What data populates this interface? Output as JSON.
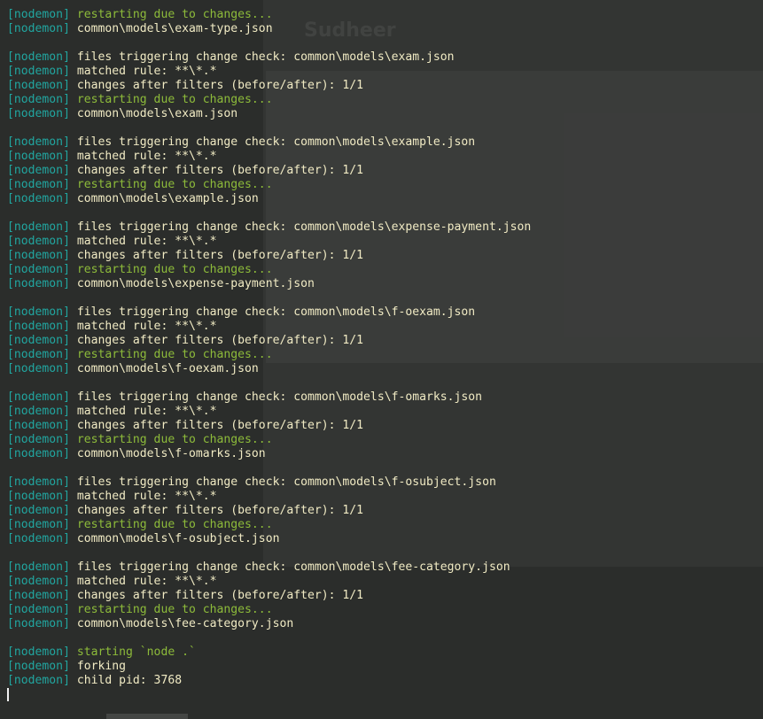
{
  "terminal": {
    "tag": "[nodemon]",
    "lines": [
      {
        "type": "green",
        "text": "restarting due to changes..."
      },
      {
        "type": "yellow",
        "text": "common\\models\\exam-type.json"
      },
      {
        "type": "blank"
      },
      {
        "type": "yellow",
        "text": "files triggering change check: common\\models\\exam.json"
      },
      {
        "type": "yellow",
        "text": "matched rule: **\\*.*"
      },
      {
        "type": "yellow",
        "text": "changes after filters (before/after): 1/1"
      },
      {
        "type": "green",
        "text": "restarting due to changes..."
      },
      {
        "type": "yellow",
        "text": "common\\models\\exam.json"
      },
      {
        "type": "blank"
      },
      {
        "type": "yellow",
        "text": "files triggering change check: common\\models\\example.json"
      },
      {
        "type": "yellow",
        "text": "matched rule: **\\*.*"
      },
      {
        "type": "yellow",
        "text": "changes after filters (before/after): 1/1"
      },
      {
        "type": "green",
        "text": "restarting due to changes..."
      },
      {
        "type": "yellow",
        "text": "common\\models\\example.json"
      },
      {
        "type": "blank"
      },
      {
        "type": "yellow",
        "text": "files triggering change check: common\\models\\expense-payment.json"
      },
      {
        "type": "yellow",
        "text": "matched rule: **\\*.*"
      },
      {
        "type": "yellow",
        "text": "changes after filters (before/after): 1/1"
      },
      {
        "type": "green",
        "text": "restarting due to changes..."
      },
      {
        "type": "yellow",
        "text": "common\\models\\expense-payment.json"
      },
      {
        "type": "blank"
      },
      {
        "type": "yellow",
        "text": "files triggering change check: common\\models\\f-oexam.json"
      },
      {
        "type": "yellow",
        "text": "matched rule: **\\*.*"
      },
      {
        "type": "yellow",
        "text": "changes after filters (before/after): 1/1"
      },
      {
        "type": "green",
        "text": "restarting due to changes..."
      },
      {
        "type": "yellow",
        "text": "common\\models\\f-oexam.json"
      },
      {
        "type": "blank"
      },
      {
        "type": "yellow",
        "text": "files triggering change check: common\\models\\f-omarks.json"
      },
      {
        "type": "yellow",
        "text": "matched rule: **\\*.*"
      },
      {
        "type": "yellow",
        "text": "changes after filters (before/after): 1/1"
      },
      {
        "type": "green",
        "text": "restarting due to changes..."
      },
      {
        "type": "yellow",
        "text": "common\\models\\f-omarks.json"
      },
      {
        "type": "blank"
      },
      {
        "type": "yellow",
        "text": "files triggering change check: common\\models\\f-osubject.json"
      },
      {
        "type": "yellow",
        "text": "matched rule: **\\*.*"
      },
      {
        "type": "yellow",
        "text": "changes after filters (before/after): 1/1"
      },
      {
        "type": "green",
        "text": "restarting due to changes..."
      },
      {
        "type": "yellow",
        "text": "common\\models\\f-osubject.json"
      },
      {
        "type": "blank"
      },
      {
        "type": "yellow",
        "text": "files triggering change check: common\\models\\fee-category.json"
      },
      {
        "type": "yellow",
        "text": "matched rule: **\\*.*"
      },
      {
        "type": "yellow",
        "text": "changes after filters (before/after): 1/1"
      },
      {
        "type": "green",
        "text": "restarting due to changes..."
      },
      {
        "type": "yellow",
        "text": "common\\models\\fee-category.json"
      },
      {
        "type": "blank"
      },
      {
        "type": "green",
        "text": "starting `node .`"
      },
      {
        "type": "yellow",
        "text": "forking"
      },
      {
        "type": "yellow",
        "text": "child pid: 3768"
      },
      {
        "type": "cursor"
      }
    ]
  },
  "background_window": {
    "title": "Sudheer"
  }
}
